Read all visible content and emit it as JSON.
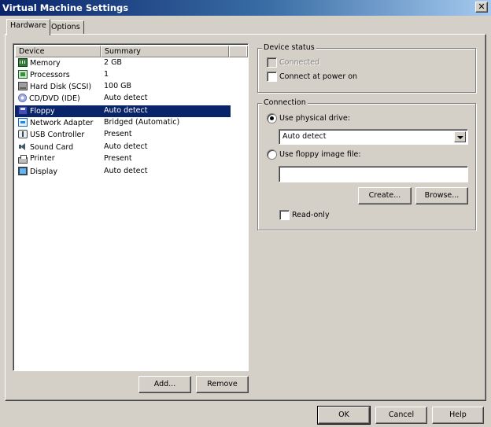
{
  "window": {
    "title": "Virtual Machine Settings",
    "close_glyph": "✕"
  },
  "tabs": [
    {
      "label": "Hardware",
      "active": true
    },
    {
      "label": "Options",
      "active": false
    }
  ],
  "device_list": {
    "columns": [
      "Device",
      "Summary"
    ],
    "rows": [
      {
        "device": "Memory",
        "summary": "2 GB",
        "icon": "memory-icon"
      },
      {
        "device": "Processors",
        "summary": "1",
        "icon": "processor-icon"
      },
      {
        "device": "Hard Disk (SCSI)",
        "summary": "100 GB",
        "icon": "hard-disk-icon"
      },
      {
        "device": "CD/DVD (IDE)",
        "summary": "Auto detect",
        "icon": "cd-dvd-icon"
      },
      {
        "device": "Floppy",
        "summary": "Auto detect",
        "icon": "floppy-icon",
        "selected": true
      },
      {
        "device": "Network Adapter",
        "summary": "Bridged (Automatic)",
        "icon": "network-adapter-icon"
      },
      {
        "device": "USB Controller",
        "summary": "Present",
        "icon": "usb-icon"
      },
      {
        "device": "Sound Card",
        "summary": "Auto detect",
        "icon": "sound-card-icon"
      },
      {
        "device": "Printer",
        "summary": "Present",
        "icon": "printer-icon"
      },
      {
        "device": "Display",
        "summary": "Auto detect",
        "icon": "display-icon"
      }
    ]
  },
  "list_buttons": {
    "add": "Add...",
    "remove": "Remove"
  },
  "device_status": {
    "title": "Device status",
    "connected_label": "Connected",
    "connected_checked": false,
    "connected_enabled": false,
    "connect_at_power_on_label": "Connect at power on",
    "connect_at_power_on_checked": false
  },
  "connection": {
    "title": "Connection",
    "use_physical_drive_label": "Use physical drive:",
    "use_physical_drive_selected": true,
    "physical_drive_value": "Auto detect",
    "use_image_label": "Use floppy image file:",
    "use_image_selected": false,
    "image_file_value": "",
    "create_label": "Create...",
    "browse_label": "Browse...",
    "read_only_label": "Read-only",
    "read_only_checked": false
  },
  "dialog_buttons": {
    "ok": "OK",
    "cancel": "Cancel",
    "help": "Help"
  }
}
